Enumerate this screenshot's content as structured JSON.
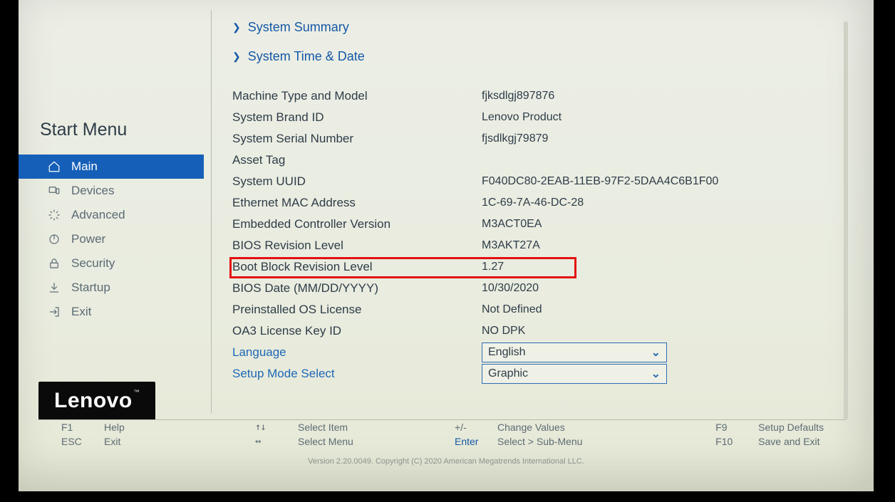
{
  "sidebar": {
    "title": "Start Menu",
    "items": [
      {
        "label": "Main",
        "icon": "home-icon",
        "active": true
      },
      {
        "label": "Devices",
        "icon": "devices-icon",
        "active": false
      },
      {
        "label": "Advanced",
        "icon": "advanced-icon",
        "active": false
      },
      {
        "label": "Power",
        "icon": "power-icon",
        "active": false
      },
      {
        "label": "Security",
        "icon": "lock-icon",
        "active": false
      },
      {
        "label": "Startup",
        "icon": "startup-icon",
        "active": false
      },
      {
        "label": "Exit",
        "icon": "exit-icon",
        "active": false
      }
    ]
  },
  "logo": {
    "text": "Lenovo",
    "tm": "™"
  },
  "content": {
    "submenus": [
      {
        "label": "System Summary"
      },
      {
        "label": "System Time & Date"
      }
    ],
    "rows": [
      {
        "label": "Machine Type and Model",
        "value": "fjksdlgj897876"
      },
      {
        "label": "System Brand ID",
        "value": "Lenovo Product"
      },
      {
        "label": "System Serial Number",
        "value": "fjsdlkgj79879"
      },
      {
        "label": "Asset Tag",
        "value": ""
      },
      {
        "label": "System UUID",
        "value": "F040DC80-2EAB-11EB-97F2-5DAA4C6B1F00"
      },
      {
        "label": "Ethernet MAC Address",
        "value": "1C-69-7A-46-DC-28"
      },
      {
        "label": "Embedded Controller Version",
        "value": "M3ACT0EA"
      },
      {
        "label": "BIOS Revision Level",
        "value": "M3AKT27A",
        "highlight": true
      },
      {
        "label": "Boot Block Revision Level",
        "value": "1.27"
      },
      {
        "label": "BIOS Date (MM/DD/YYYY)",
        "value": "10/30/2020"
      },
      {
        "label": "Preinstalled OS License",
        "value": "Not Defined"
      },
      {
        "label": "OA3 License Key ID",
        "value": "NO DPK"
      }
    ],
    "selects": [
      {
        "label": "Language",
        "value": "English"
      },
      {
        "label": "Setup Mode Select",
        "value": "Graphic"
      }
    ]
  },
  "footer": {
    "f1": {
      "key": "F1",
      "label": "Help"
    },
    "esc": {
      "key": "ESC",
      "label": "Exit"
    },
    "updown": {
      "key": "↑↓",
      "label": "Select Item"
    },
    "leftright": {
      "key": "↔",
      "label": "Select Menu"
    },
    "plusminus": {
      "key": "+/-",
      "label": "Change Values"
    },
    "enter": {
      "key": "Enter",
      "label": "Select > Sub-Menu"
    },
    "f9": {
      "key": "F9",
      "label": "Setup Defaults"
    },
    "f10": {
      "key": "F10",
      "label": "Save and Exit"
    }
  },
  "copyright": "Version 2.20.0049. Copyright (C) 2020 American Megatrends International LLC."
}
